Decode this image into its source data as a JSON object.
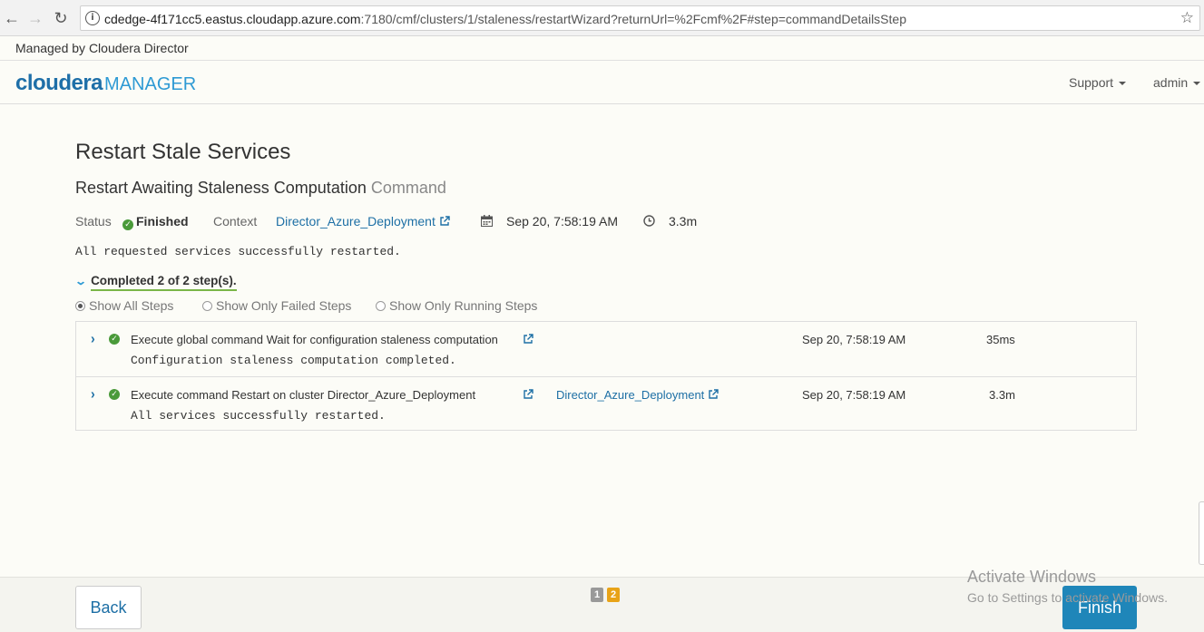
{
  "browser": {
    "url_host": "cdedge-4f171cc5.eastus.cloudapp.azure.com",
    "url_path": ":7180/cmf/clusters/1/staleness/restartWizard?returnUrl=%2Fcmf%2F#step=commandDetailsStep"
  },
  "managed_by": "Managed by Cloudera Director",
  "header": {
    "brand": "cloudera",
    "product": "MANAGER",
    "support_label": "Support",
    "user_label": "admin"
  },
  "page": {
    "title": "Restart Stale Services",
    "command_name": "Restart Awaiting Staleness Computation",
    "command_suffix": "Command"
  },
  "status": {
    "status_label": "Status",
    "status_value": "Finished",
    "context_label": "Context",
    "context_value": "Director_Azure_Deployment",
    "start_time": "Sep 20, 7:58:19 AM",
    "duration": "3.3m",
    "message": "All requested services successfully restarted."
  },
  "steps_summary": "Completed 2 of 2 step(s).",
  "filters": [
    "Show All Steps",
    "Show Only Failed Steps",
    "Show Only Running Steps"
  ],
  "steps": [
    {
      "name": "Execute global command Wait for configuration staleness computation",
      "message": "Configuration staleness computation completed.",
      "context": "",
      "time": "Sep 20, 7:58:19 AM",
      "duration": "35ms"
    },
    {
      "name": "Execute command Restart on cluster Director_Azure_Deployment",
      "message": "All services successfully restarted.",
      "context": "Director_Azure_Deployment",
      "time": "Sep 20, 7:58:19 AM",
      "duration": "3.3m"
    }
  ],
  "footer": {
    "back_label": "Back",
    "finish_label": "Finish",
    "pages": [
      "1",
      "2"
    ]
  },
  "watermark": {
    "line1": "Activate Windows",
    "line2": "Go to Settings to activate Windows."
  },
  "colors": {
    "accent": "#1f86b9",
    "success": "#4a9a3a",
    "link": "#1d6fa5",
    "current_page": "#e8a317",
    "other_page": "#999999"
  }
}
